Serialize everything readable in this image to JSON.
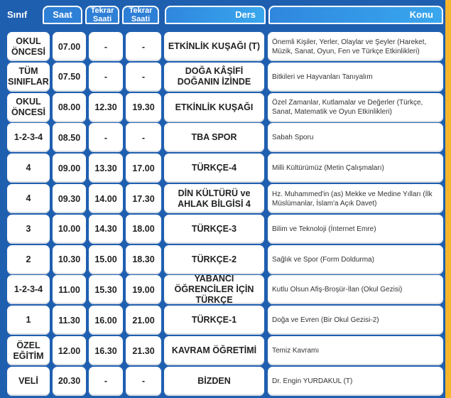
{
  "headers": {
    "sinif": "Sınıf",
    "saat": "Saat",
    "tekrar1": "Tekrar Saati",
    "tekrar2": "Tekrar Saati",
    "ders": "Ders",
    "konu": "Konu"
  },
  "rows": [
    {
      "sinif": "OKUL ÖNCESİ",
      "saat": "07.00",
      "t1": "-",
      "t2": "-",
      "ders": "ETKİNLİK KUŞAĞI (T)",
      "konu": "Önemli Kişiler, Yerler, Olaylar ve Şeyler (Hareket, Müzik, Sanat, Oyun, Fen ve Türkçe Etkinlikleri)"
    },
    {
      "sinif": "TÜM SINIFLAR",
      "saat": "07.50",
      "t1": "-",
      "t2": "-",
      "ders": "DOĞA KÂŞİFİ DOĞANIN İZİNDE",
      "konu": "Bitkileri ve Hayvanları Tanıyalım"
    },
    {
      "sinif": "OKUL ÖNCESİ",
      "saat": "08.00",
      "t1": "12.30",
      "t2": "19.30",
      "ders": "ETKİNLİK KUŞAĞI",
      "konu": "Özel Zamanlar, Kutlamalar ve Değerler (Türkçe, Sanat, Matematik ve Oyun Etkinlikleri)"
    },
    {
      "sinif": "1-2-3-4",
      "saat": "08.50",
      "t1": "-",
      "t2": "-",
      "ders": "TBA SPOR",
      "konu": "Sabah Sporu"
    },
    {
      "sinif": "4",
      "saat": "09.00",
      "t1": "13.30",
      "t2": "17.00",
      "ders": "TÜRKÇE-4",
      "konu": "Milli Kültürümüz (Metin Çalışmaları)"
    },
    {
      "sinif": "4",
      "saat": "09.30",
      "t1": "14.00",
      "t2": "17.30",
      "ders": "DİN KÜLTÜRÜ ve AHLAK BİLGİSİ 4",
      "konu": "Hz. Muhammed'in (as) Mekke ve Medine Yılları (İlk Müslümanlar, İslam'a Açık Davet)"
    },
    {
      "sinif": "3",
      "saat": "10.00",
      "t1": "14.30",
      "t2": "18.00",
      "ders": "TÜRKÇE-3",
      "konu": "Bilim ve Teknoloji (İnternet Emre)"
    },
    {
      "sinif": "2",
      "saat": "10.30",
      "t1": "15.00",
      "t2": "18.30",
      "ders": "TÜRKÇE-2",
      "konu": "Sağlık ve Spor (Form Doldurma)"
    },
    {
      "sinif": "1-2-3-4",
      "saat": "11.00",
      "t1": "15.30",
      "t2": "19.00",
      "ders": "YABANCI ÖĞRENCİLER İÇİN TÜRKÇE",
      "konu": "Kutlu Olsun Afiş-Broşür-İlan (Okul Gezisi)"
    },
    {
      "sinif": "1",
      "saat": "11.30",
      "t1": "16.00",
      "t2": "21.00",
      "ders": "TÜRKÇE-1",
      "konu": "Doğa ve Evren (Bir Okul Gezisi-2)"
    },
    {
      "sinif": "ÖZEL EĞİTİM",
      "saat": "12.00",
      "t1": "16.30",
      "t2": "21.30",
      "ders": "KAVRAM ÖĞRETİMİ",
      "konu": "Temiz Kavramı"
    },
    {
      "sinif": "VELİ",
      "saat": "20.30",
      "t1": "-",
      "t2": "-",
      "ders": "BİZDEN",
      "konu": "Dr. Engin YURDAKUL (T)"
    }
  ]
}
